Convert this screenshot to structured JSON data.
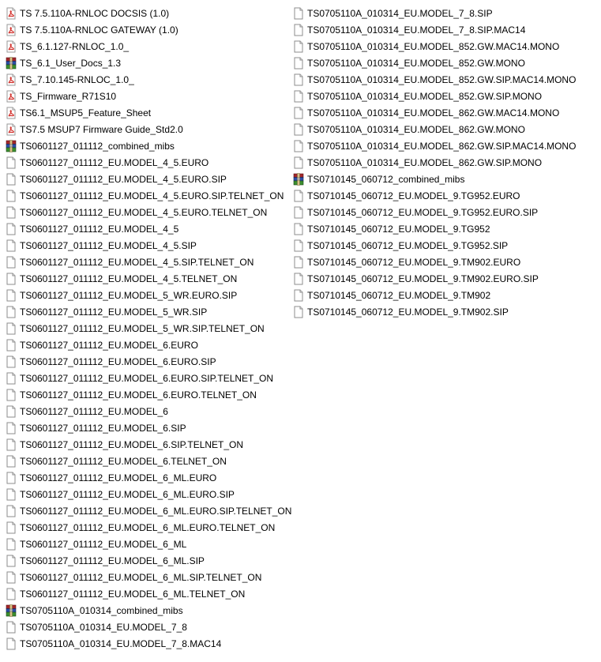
{
  "colors": {
    "pdf_red": "#d2322d",
    "archive_red": "#a3262a",
    "archive_blue": "#2b4fa8",
    "archive_green": "#3b8f2f",
    "generic_gray": "#8c8c8c",
    "hover_bg": "#e5f3ff"
  },
  "files": [
    {
      "name": "TS 7.5.110A-RNLOC DOCSIS (1.0)",
      "icon": "pdf-icon"
    },
    {
      "name": "TS 7.5.110A-RNLOC GATEWAY (1.0)",
      "icon": "pdf-icon"
    },
    {
      "name": "TS_6.1.127-RNLOC_1.0_",
      "icon": "pdf-icon"
    },
    {
      "name": "TS_6.1_User_Docs_1.3",
      "icon": "archive-icon"
    },
    {
      "name": "TS_7.10.145-RNLOC_1.0_",
      "icon": "pdf-icon"
    },
    {
      "name": "TS_Firmware_R71S10",
      "icon": "pdf-icon"
    },
    {
      "name": "TS6.1_MSUP5_Feature_Sheet",
      "icon": "pdf-icon"
    },
    {
      "name": "TS7.5 MSUP7 Firmware Guide_Std2.0",
      "icon": "pdf-icon"
    },
    {
      "name": "TS0601127_011112_combined_mibs",
      "icon": "archive-icon"
    },
    {
      "name": "TS0601127_011112_EU.MODEL_4_5.EURO",
      "icon": "file-icon"
    },
    {
      "name": "TS0601127_011112_EU.MODEL_4_5.EURO.SIP",
      "icon": "file-icon"
    },
    {
      "name": "TS0601127_011112_EU.MODEL_4_5.EURO.SIP.TELNET_ON",
      "icon": "file-icon"
    },
    {
      "name": "TS0601127_011112_EU.MODEL_4_5.EURO.TELNET_ON",
      "icon": "file-icon"
    },
    {
      "name": "TS0601127_011112_EU.MODEL_4_5",
      "icon": "file-icon"
    },
    {
      "name": "TS0601127_011112_EU.MODEL_4_5.SIP",
      "icon": "file-icon"
    },
    {
      "name": "TS0601127_011112_EU.MODEL_4_5.SIP.TELNET_ON",
      "icon": "file-icon"
    },
    {
      "name": "TS0601127_011112_EU.MODEL_4_5.TELNET_ON",
      "icon": "file-icon"
    },
    {
      "name": "TS0601127_011112_EU.MODEL_5_WR.EURO.SIP",
      "icon": "file-icon"
    },
    {
      "name": "TS0601127_011112_EU.MODEL_5_WR.SIP",
      "icon": "file-icon"
    },
    {
      "name": "TS0601127_011112_EU.MODEL_5_WR.SIP.TELNET_ON",
      "icon": "file-icon"
    },
    {
      "name": "TS0601127_011112_EU.MODEL_6.EURO",
      "icon": "file-icon"
    },
    {
      "name": "TS0601127_011112_EU.MODEL_6.EURO.SIP",
      "icon": "file-icon"
    },
    {
      "name": "TS0601127_011112_EU.MODEL_6.EURO.SIP.TELNET_ON",
      "icon": "file-icon"
    },
    {
      "name": "TS0601127_011112_EU.MODEL_6.EURO.TELNET_ON",
      "icon": "file-icon"
    },
    {
      "name": "TS0601127_011112_EU.MODEL_6",
      "icon": "file-icon"
    },
    {
      "name": "TS0601127_011112_EU.MODEL_6.SIP",
      "icon": "file-icon"
    },
    {
      "name": "TS0601127_011112_EU.MODEL_6.SIP.TELNET_ON",
      "icon": "file-icon"
    },
    {
      "name": "TS0601127_011112_EU.MODEL_6.TELNET_ON",
      "icon": "file-icon"
    },
    {
      "name": "TS0601127_011112_EU.MODEL_6_ML.EURO",
      "icon": "file-icon"
    },
    {
      "name": "TS0601127_011112_EU.MODEL_6_ML.EURO.SIP",
      "icon": "file-icon"
    },
    {
      "name": "TS0601127_011112_EU.MODEL_6_ML.EURO.SIP.TELNET_ON",
      "icon": "file-icon"
    },
    {
      "name": "TS0601127_011112_EU.MODEL_6_ML.EURO.TELNET_ON",
      "icon": "file-icon"
    },
    {
      "name": "TS0601127_011112_EU.MODEL_6_ML",
      "icon": "file-icon"
    },
    {
      "name": "TS0601127_011112_EU.MODEL_6_ML.SIP",
      "icon": "file-icon"
    },
    {
      "name": "TS0601127_011112_EU.MODEL_6_ML.SIP.TELNET_ON",
      "icon": "file-icon"
    },
    {
      "name": "TS0601127_011112_EU.MODEL_6_ML.TELNET_ON",
      "icon": "file-icon"
    },
    {
      "name": "TS0705110A_010314_combined_mibs",
      "icon": "archive-icon"
    },
    {
      "name": "TS0705110A_010314_EU.MODEL_7_8",
      "icon": "file-icon"
    },
    {
      "name": "TS0705110A_010314_EU.MODEL_7_8.MAC14",
      "icon": "file-icon"
    },
    {
      "name": "TS0705110A_010314_EU.MODEL_7_8.SIP",
      "icon": "file-icon"
    },
    {
      "name": "TS0705110A_010314_EU.MODEL_7_8.SIP.MAC14",
      "icon": "file-icon"
    },
    {
      "name": "TS0705110A_010314_EU.MODEL_852.GW.MAC14.MONO",
      "icon": "file-icon"
    },
    {
      "name": "TS0705110A_010314_EU.MODEL_852.GW.MONO",
      "icon": "file-icon"
    },
    {
      "name": "TS0705110A_010314_EU.MODEL_852.GW.SIP.MAC14.MONO",
      "icon": "file-icon"
    },
    {
      "name": "TS0705110A_010314_EU.MODEL_852.GW.SIP.MONO",
      "icon": "file-icon"
    },
    {
      "name": "TS0705110A_010314_EU.MODEL_862.GW.MAC14.MONO",
      "icon": "file-icon"
    },
    {
      "name": "TS0705110A_010314_EU.MODEL_862.GW.MONO",
      "icon": "file-icon"
    },
    {
      "name": "TS0705110A_010314_EU.MODEL_862.GW.SIP.MAC14.MONO",
      "icon": "file-icon"
    },
    {
      "name": "TS0705110A_010314_EU.MODEL_862.GW.SIP.MONO",
      "icon": "file-icon"
    },
    {
      "name": "TS0710145_060712_combined_mibs",
      "icon": "archive-icon"
    },
    {
      "name": "TS0710145_060712_EU.MODEL_9.TG952.EURO",
      "icon": "file-icon"
    },
    {
      "name": "TS0710145_060712_EU.MODEL_9.TG952.EURO.SIP",
      "icon": "file-icon"
    },
    {
      "name": "TS0710145_060712_EU.MODEL_9.TG952",
      "icon": "file-icon"
    },
    {
      "name": "TS0710145_060712_EU.MODEL_9.TG952.SIP",
      "icon": "file-icon"
    },
    {
      "name": "TS0710145_060712_EU.MODEL_9.TM902.EURO",
      "icon": "file-icon"
    },
    {
      "name": "TS0710145_060712_EU.MODEL_9.TM902.EURO.SIP",
      "icon": "file-icon"
    },
    {
      "name": "TS0710145_060712_EU.MODEL_9.TM902",
      "icon": "file-icon"
    },
    {
      "name": "TS0710145_060712_EU.MODEL_9.TM902.SIP",
      "icon": "file-icon"
    }
  ]
}
